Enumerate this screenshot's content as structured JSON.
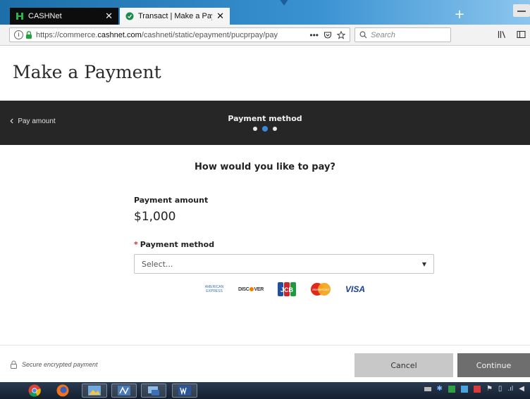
{
  "browser": {
    "tabs": [
      {
        "title": "CASHNet",
        "active": false,
        "icon": "cashnet-favicon-icon",
        "close": "✕"
      },
      {
        "title": "Transact | Make a Payment",
        "active": true,
        "icon": "transact-favicon-icon",
        "close": "✕"
      }
    ],
    "new_tab": "+",
    "url": {
      "prefix": "https://commerce.",
      "domain": "cashnet.com",
      "path": "/cashneti/static/epayment/pucprpay/pay"
    },
    "url_actions": {
      "more": "•••"
    },
    "search_placeholder": "Search"
  },
  "page": {
    "title": "Make a Payment",
    "steps": {
      "back_label": "Pay amount",
      "current_title": "Payment method",
      "total": 3,
      "current_index": 1
    },
    "question": "How would you like to pay?",
    "payment_amount_label": "Payment amount",
    "payment_amount_value": "$1,000",
    "payment_method_required": "*",
    "payment_method_label": "Payment method",
    "payment_method_placeholder": "Select...",
    "card_brands": {
      "amex": "AMERICAN EXPRESS",
      "discover_pre": "DISC",
      "discover_post": "VER",
      "jcb": "JCB",
      "mastercard": "MasterCard",
      "visa": "VISA"
    },
    "secure_note": "Secure encrypted payment",
    "cancel_label": "Cancel",
    "continue_label": "Continue"
  },
  "colors": {
    "accent": "#3b87d6",
    "stepbar_bg": "#262626",
    "cancel_bg": "#c8c8c8",
    "continue_bg": "#6e6e6e",
    "required": "#d32f2f"
  }
}
